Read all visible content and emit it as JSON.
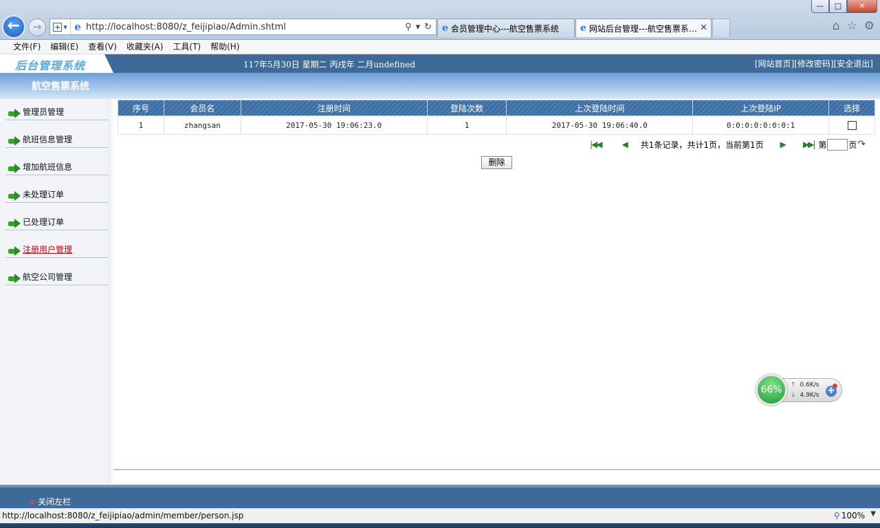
{
  "browser": {
    "url": "http://localhost:8080/z_feijipiao/Admin.shtml",
    "tabs": [
      {
        "label": "会员管理中心---航空售票系统",
        "active": false
      },
      {
        "label": "网站后台管理---航空售票系…",
        "active": true
      }
    ],
    "menu": [
      "文件(F)",
      "编辑(E)",
      "查看(V)",
      "收藏夹(A)",
      "工具(T)",
      "帮助(H)"
    ],
    "status_url": "http://localhost:8080/z_feijipiao/admin/member/person.jsp",
    "zoom": "100%"
  },
  "header": {
    "logo": "后台管理系统",
    "datetime": "117年5月30日 星期二 丙戌年 二月undefined",
    "links": [
      "[网站首页]",
      "[修改密码]",
      "[安全退出]"
    ]
  },
  "subheader": {
    "title": "航空售票系统"
  },
  "sidebar": {
    "items": [
      {
        "label": "管理员管理",
        "active": false
      },
      {
        "label": "航班信息管理",
        "active": false
      },
      {
        "label": "增加航班信息",
        "active": false
      },
      {
        "label": "未处理订单",
        "active": false
      },
      {
        "label": "已处理订单",
        "active": false
      },
      {
        "label": "注册用户管理",
        "active": true
      },
      {
        "label": "航空公司管理",
        "active": false
      }
    ]
  },
  "table": {
    "columns": [
      "序号",
      "会员名",
      "注册时间",
      "登陆次数",
      "上次登陆时间",
      "上次登陆IP",
      "选择"
    ],
    "rows": [
      [
        "1",
        "zhangsan",
        "2017-05-30 19:06:23.0",
        "1",
        "2017-05-30 19:06:40.0",
        "0:0:0:0:0:0:0:1"
      ]
    ]
  },
  "pager": {
    "summary": "共1条记录，共计1页，当前第1页",
    "page_prefix": "第",
    "page_suffix": "页"
  },
  "actions": {
    "delete": "删除"
  },
  "footer": {
    "close_left": "关闭左栏"
  },
  "netwidget": {
    "percent": "66%",
    "up": "0.6K/s",
    "down": "4.9K/s"
  }
}
